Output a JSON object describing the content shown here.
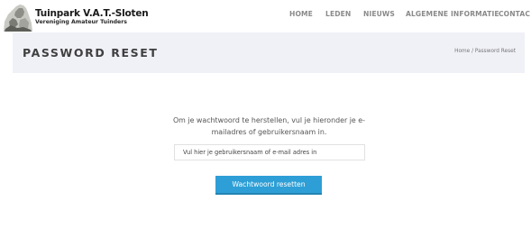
{
  "site": {
    "name": "Tuinpark V.A.T.-Sloten",
    "tagline": "Vereniging Amateur Tuinders"
  },
  "nav": {
    "items": [
      {
        "label": "HOME"
      },
      {
        "label": "LEDEN"
      },
      {
        "label": "NIEUWS"
      },
      {
        "label": "ALGEMENE INFORMATIE"
      },
      {
        "label": "CONTAC"
      }
    ]
  },
  "page": {
    "title": "PASSWORD RESET",
    "breadcrumb": {
      "home": "Home",
      "separator": " / ",
      "current": "Password Reset"
    }
  },
  "form": {
    "intro": "Om je wachtwoord te herstellen, vul je hieronder je e-mailadres of gebruikersnaam in.",
    "input_placeholder": "Vul hier je gebruikersnaam of e-mail adres in",
    "input_value": "",
    "button_label": "Wachtwoord resetten"
  },
  "colors": {
    "accent": "#2e9fd6",
    "title_bar_bg": "#f0f1f7",
    "nav_text": "#8a8a8a"
  },
  "icons": {
    "logo": "garden-statue-icon"
  }
}
